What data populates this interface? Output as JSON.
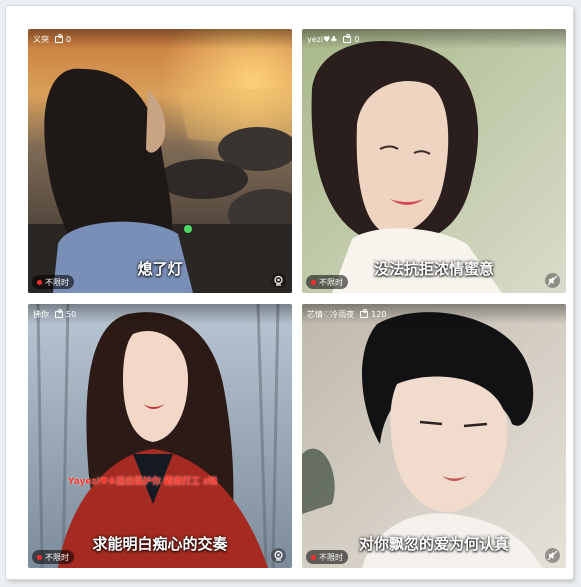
{
  "cards": [
    {
      "uploader": "义突",
      "gift_count": "0",
      "caption": "熄了灯",
      "badge": "不限时",
      "corner_icon": "live-camera-icon"
    },
    {
      "uploader": "yezi♥♣",
      "gift_count": "0",
      "caption": "没法抗拒浓情蜜意",
      "badge": "不限时",
      "corner_icon": "mute-icon"
    },
    {
      "uploader": "拂你",
      "gift_count": "50",
      "caption": "求能明白痴心的交奏",
      "ticker": "Yayezi♥♣送出保护你  霸道打工 z晓",
      "badge": "不限时",
      "corner_icon": "live-camera-icon"
    },
    {
      "uploader": "芯情♡冷雨夜",
      "gift_count": "120",
      "caption": "对你飘忽的爱为何认真",
      "badge": "不限时",
      "corner_icon": "mute-icon"
    }
  ],
  "colors": {
    "page_bg": "#eceff1",
    "frame_bg": "#ffffff",
    "badge_dot": "#ff2d2d",
    "ticker_text": "#ff3b30"
  }
}
